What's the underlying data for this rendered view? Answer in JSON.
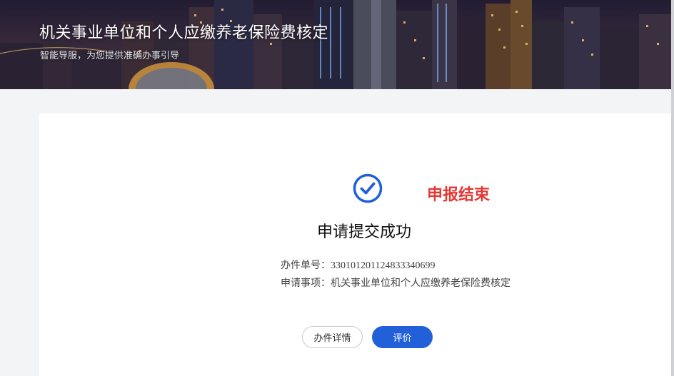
{
  "banner": {
    "title": "机关事业单位和个人应缴养老保险费核定",
    "subtitle": "智能导服，为您提供准确办事引导"
  },
  "result": {
    "end_label": "申报结束",
    "success_title": "申请提交成功",
    "order_label": "办件单号：",
    "order_value": "330101201124833340699",
    "item_label": "申请事项：",
    "item_value": "机关事业单位和个人应缴养老保险费核定"
  },
  "buttons": {
    "detail": "办件详情",
    "rate": "评价"
  },
  "colors": {
    "accent": "#2160d8",
    "end_label": "#e53935",
    "card_bg": "#ffffff",
    "page_bg": "#f3f4f6"
  },
  "icons": {
    "status": "check-circle-icon"
  }
}
